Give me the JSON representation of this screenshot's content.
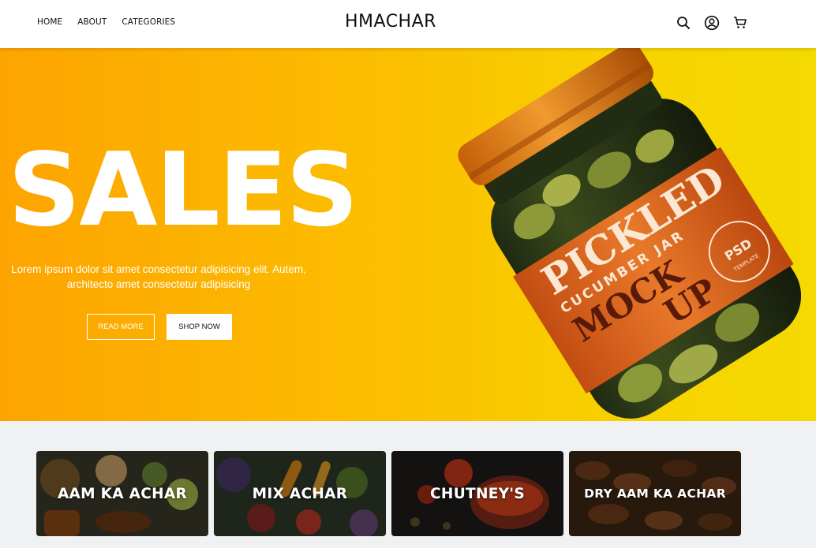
{
  "header": {
    "nav": [
      "HOME",
      "ABOUT",
      "CATEGORIES"
    ],
    "brand": "HMACHAR",
    "icons": [
      "search-icon",
      "account-icon",
      "cart-icon"
    ]
  },
  "hero": {
    "headline": "SALES",
    "description": "Lorem ipsum dolor sit amet consectetur adipisicing elit. Autem, architecto amet consectetur adipisicing",
    "read_more_label": "READ MORE",
    "shop_now_label": "SHOP NOW",
    "jar_label": {
      "line1": "PICKLED",
      "line2": "CUCUMBER JAR",
      "line3": "MOCK",
      "line4": "UP",
      "badge_main": "PSD",
      "badge_sub": "TEMPLATE"
    }
  },
  "categories": [
    {
      "label": "AAM KA ACHAR"
    },
    {
      "label": "MIX ACHAR"
    },
    {
      "label": "CHUTNEY'S"
    },
    {
      "label": "DRY AAM KA ACHAR"
    }
  ],
  "colors": {
    "hero_start": "#fda400",
    "hero_end": "#f4da00",
    "jar_label": "#d9621a",
    "lid": "#d5720f"
  }
}
